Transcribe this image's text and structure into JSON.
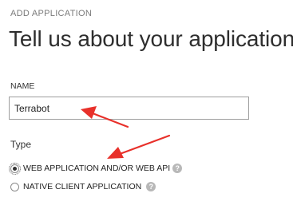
{
  "header": {
    "subtitle": "ADD APPLICATION",
    "title": "Tell us about your application"
  },
  "form": {
    "name_label": "NAME",
    "name_value": "Terrabot",
    "type_label": "Type",
    "type_options": [
      {
        "label": "WEB APPLICATION AND/OR WEB API",
        "selected": true
      },
      {
        "label": "NATIVE CLIENT APPLICATION",
        "selected": false
      }
    ],
    "help_glyph": "?"
  },
  "annotations": {
    "arrow_color": "#e8302a"
  }
}
